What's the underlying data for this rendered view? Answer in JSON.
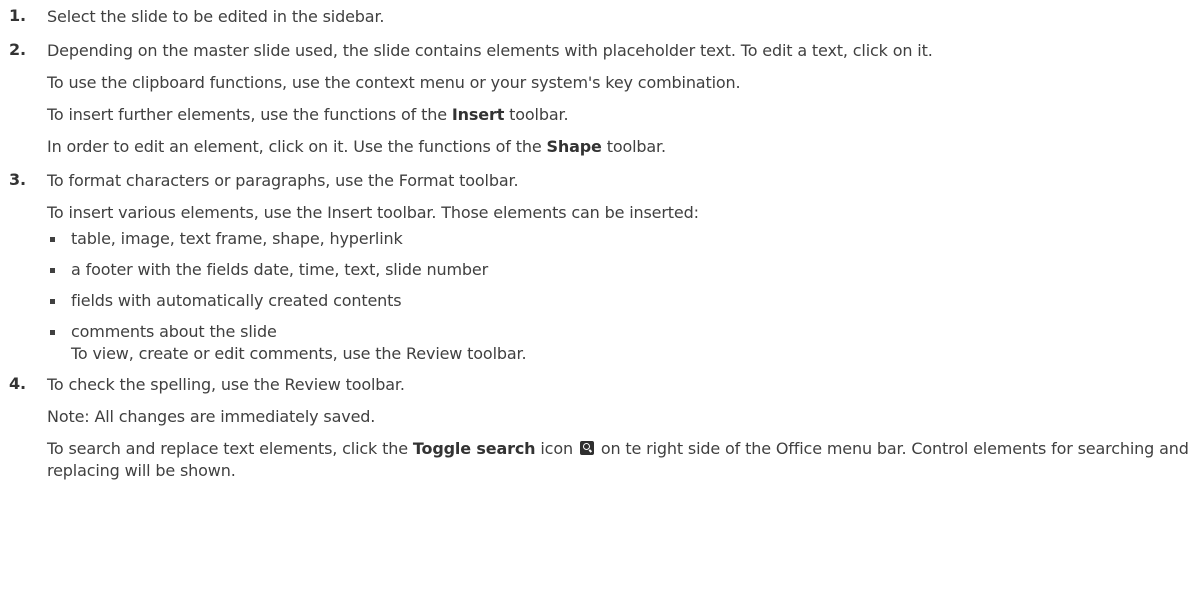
{
  "steps": [
    {
      "number": "1.",
      "lines": [
        "Select the slide to be edited in the sidebar."
      ]
    },
    {
      "number": "2.",
      "lines": [
        "Depending on the master slide used, the slide contains elements with placeholder text. To edit a text, click on it.",
        "To use the clipboard functions, use the context menu or your system's key combination."
      ],
      "insert_pre": "To insert further elements, use the functions of the ",
      "insert_bold": "Insert",
      "insert_post": " toolbar.",
      "shape_pre": "In order to edit an element, click on it. Use the functions of the ",
      "shape_bold": "Shape",
      "shape_post": " toolbar."
    },
    {
      "number": "3.",
      "lines": [
        "To format characters or paragraphs, use the Format toolbar.",
        "To insert various elements, use the Insert toolbar. Those elements can be inserted:"
      ],
      "bullets": [
        "table, image, text frame, shape, hyperlink",
        "a footer with the fields date, time, text, slide number",
        "fields with automatically created contents",
        "comments about the slide"
      ],
      "bullet_note": "To view, create or edit comments, use the Review toolbar."
    },
    {
      "number": "4.",
      "lines": [
        "To check the spelling, use the Review toolbar.",
        "Note: All changes are immediately saved."
      ],
      "search_pre": "To search and replace text elements, click the ",
      "search_bold": "Toggle search",
      "search_mid": " icon",
      "search_post": " on te right side of the Office menu bar. Control elements for searching and replacing will be shown.",
      "search_icon": "search-icon"
    }
  ]
}
